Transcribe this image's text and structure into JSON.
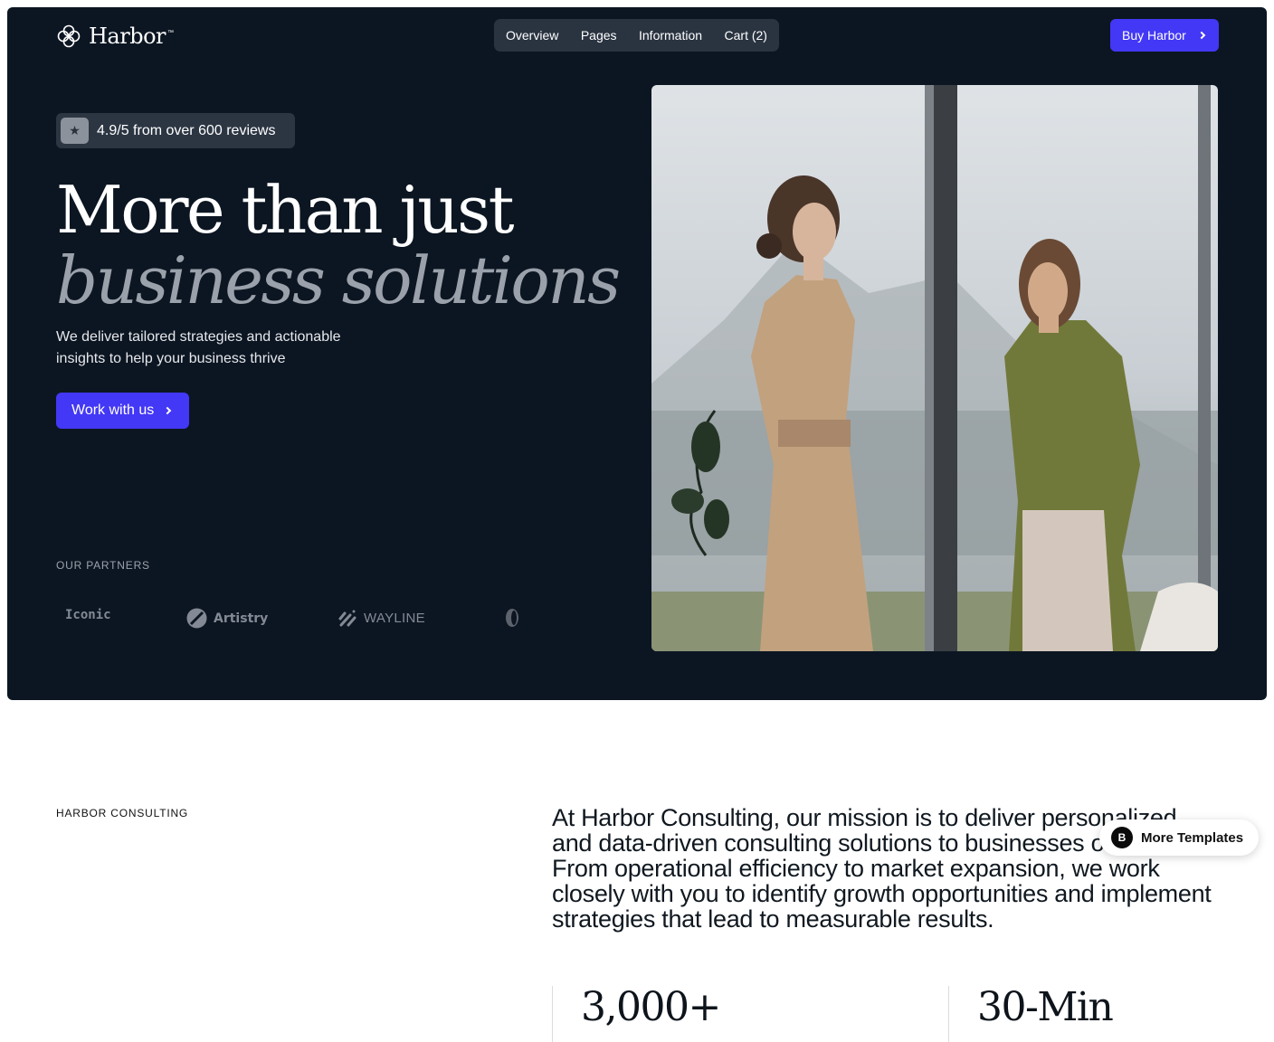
{
  "header": {
    "logo_text": "Harbor",
    "logo_tm": "™",
    "nav": [
      "Overview",
      "Pages",
      "Information",
      "Cart (2)"
    ],
    "buy_label": "Buy Harbor"
  },
  "hero": {
    "rating_score": "4.9/5",
    "rating_mid": " from over ",
    "rating_count": "600",
    "rating_tail": " reviews",
    "headline_1": "More than just",
    "headline_2": "business solutions",
    "subtitle": "We deliver tailored strategies and actionable insights to help your business thrive",
    "cta_label": "Work with us",
    "partners_label": "OUR PARTNERS",
    "partners": [
      "Iconic",
      "Artistry",
      "WAYLINE",
      ""
    ]
  },
  "about": {
    "label": "HARBOR CONSULTING",
    "mission": "At Harbor Consulting, our mission is to deliver personalized and data-driven consulting solutions to businesses of all sizes. From operational efficiency to market expansion, we work closely with you to identify growth opportunities and implement strategies that lead to measurable results.",
    "stats": [
      "3,000+",
      "30-Min"
    ]
  },
  "floating": {
    "more_templates": "More Templates"
  },
  "colors": {
    "hero_bg": "#0c1622",
    "accent": "#4338f5",
    "muted": "#9aa1ab"
  }
}
